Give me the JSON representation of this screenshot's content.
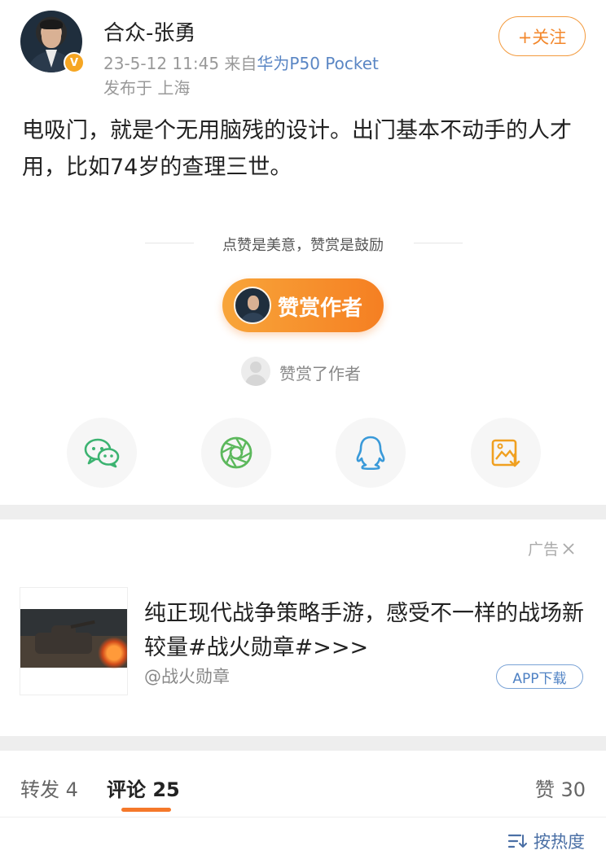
{
  "post": {
    "author": "合众-张勇",
    "timestamp": "23-5-12 11:45",
    "source_prefix": "来自",
    "device": "华为P50 Pocket",
    "location": "发布于 上海",
    "follow_label": "+关注",
    "verified_badge": "V",
    "text": "电吸门，就是个无用脑残的设计。出门基本不动手的人才用，比如74岁的查理三世。"
  },
  "reward": {
    "tagline": "点赞是美意，赞赏是鼓励",
    "button_label": "赞赏作者",
    "rewarded_text": "赞赏了作者"
  },
  "share": {
    "items": [
      {
        "icon": "wechat-icon",
        "color": "#3cb371"
      },
      {
        "icon": "moments-icon",
        "color": "#5cb85c"
      },
      {
        "icon": "qq-icon",
        "color": "#3a9ad9"
      },
      {
        "icon": "save-image-icon",
        "color": "#f0a020"
      }
    ]
  },
  "ad": {
    "label": "广告",
    "title": "纯正现代战争策略手游，感受不一样的战场新较量#战火勋章#>>>",
    "source": "@战火勋章",
    "cta": "APP下载"
  },
  "tabs": {
    "repost": "转发 4",
    "comment_label": "评论",
    "comment_count": "25",
    "like": "赞 30"
  },
  "sort": {
    "label": "按热度"
  },
  "colors": {
    "accent_orange": "#f5782a",
    "link_blue": "#5a86c4"
  }
}
